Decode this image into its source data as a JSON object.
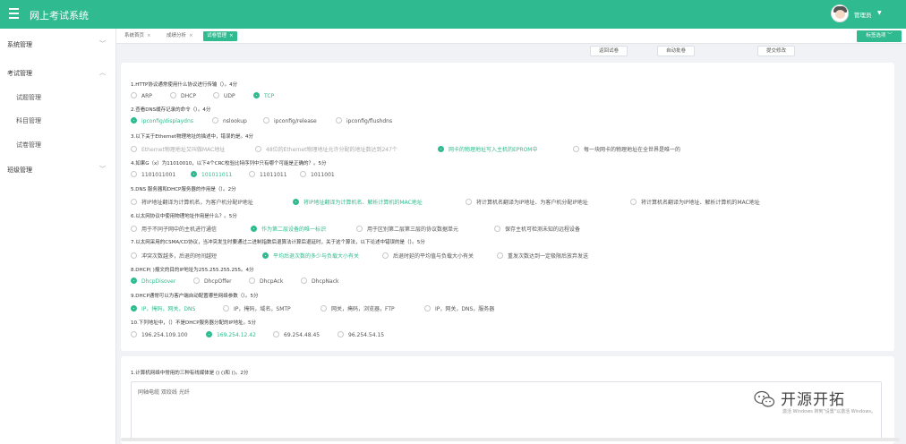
{
  "app": {
    "title": "网上考试系统"
  },
  "user": {
    "name": "管理员",
    "caret": "▼"
  },
  "sidebar": {
    "items": [
      {
        "label": "系统管理",
        "chev": "﹀"
      },
      {
        "label": "考试管理",
        "chev": "︿"
      },
      {
        "label": "试题管理"
      },
      {
        "label": "科目管理"
      },
      {
        "label": "试卷管理"
      },
      {
        "label": "班级管理",
        "chev": "﹀"
      }
    ]
  },
  "tabs": [
    {
      "label": "系统首页"
    },
    {
      "label": "成绩分析"
    },
    {
      "label": "试卷管理"
    }
  ],
  "tab_close": "×",
  "tab_dropdown": "标签选项 ﹀",
  "actions": {
    "back": "返回试卷",
    "auto_grade": "自动批卷",
    "submit": "提交修改"
  },
  "questions": [
    {
      "title": "1.HTTP协议通常使用什么协议进行传输（）。4分",
      "options": [
        "ARP",
        "DHCP",
        "UDP",
        "TCP"
      ],
      "selected": 3
    },
    {
      "title": "2.查看DNS缓存记录的命令（）。4分",
      "options": [
        "ipconfig/displaydns",
        "nslookup",
        "ipconfig/release",
        "ipconfig/flushdns"
      ],
      "selected": 0
    },
    {
      "title": "3.以下关于Ethernet物理地址的描述中，错误的是。4分",
      "options": [
        "Ethernet物理地址又叫做MAC地址",
        "48位的Ethernet物理地址允许分配的地址数达到247个",
        "网卡的物理地址写入主机的EPROM中",
        "每一块网卡的物理地址在全世界是唯一的"
      ],
      "selected": 2
    },
    {
      "title": "4.如果G（x）为11010010，以下4个CRC校验比特序列中只有哪个可能是正确的？。5分",
      "options": [
        "1101011001",
        "101011011",
        "11011011",
        "1011001"
      ],
      "selected": 1
    },
    {
      "title": "5.DNS 服务器和DHCP服务器的作用是（）。2分",
      "options": [
        "将IP地址翻译为计算机名，为客户机分配IP地址",
        "将IP地址翻译为计算机名、解析计算机的MAC地址",
        "将计算机名翻译为IP地址、为客户机分配IP地址",
        "将计算机名翻译为IP地址、解析计算机的MAC地址"
      ],
      "selected": 1
    },
    {
      "title": "6.以太网协议中使用物理地址作用是什么？。5分",
      "options": [
        "用于不同子网中的主机进行通信",
        "作为第二层设备的唯一标识",
        "用于区别第二层第三层的协议数据单元",
        "保存主机可检测未知的远程设备"
      ],
      "selected": 1
    },
    {
      "title": "7.以太网采用的CSMA/CD协议，当冲突发生时要通过二进制指数后退算法计算后退延时，关于这个算法，以下论述中错误的是（）。5分",
      "options": [
        "冲突次数越多，后退的时间越短",
        "平均后退次数的多少与负载大小有关",
        "后退时延的平均值与负载大小有关",
        "重发次数达到一定极限后放弃发送"
      ],
      "selected": 1
    },
    {
      "title": "8.DHCP(  )报文的目的IP地址为255.255.255.255。4分",
      "options": [
        "DhcpDisover",
        "DhcpOffer",
        "DhcpAck",
        "DhcpNack"
      ],
      "selected": 0
    },
    {
      "title": "9.DHCP通常可以为客户端自动配置哪些网络参数（）。5分",
      "options": [
        "IP，掩码，网关，DNS",
        "IP，掩码，域名，SMTP",
        "网关，掩码，浏览器，FTP",
        "IP，网关，DNS，服务器"
      ],
      "selected": 0
    },
    {
      "title": "10.下列地址中，（）不是DHCP服务器分配的IP地址。5分",
      "options": [
        "196.254.109.100",
        "169.254.12.42",
        "69.254.48.45",
        "96.254.54.15"
      ],
      "selected": 1
    }
  ],
  "fill_question": {
    "title": "1.计算机网络中常用的三种有线媒体是 ()  ()和 ()。2分",
    "answer": "同轴电缆 双绞线 光纤"
  },
  "watermark": {
    "text": "开源开拓",
    "sub": "激活 Windows\n转到\"设置\"以激活 Windows。"
  },
  "colors": {
    "brand": "#2fbb8f"
  }
}
